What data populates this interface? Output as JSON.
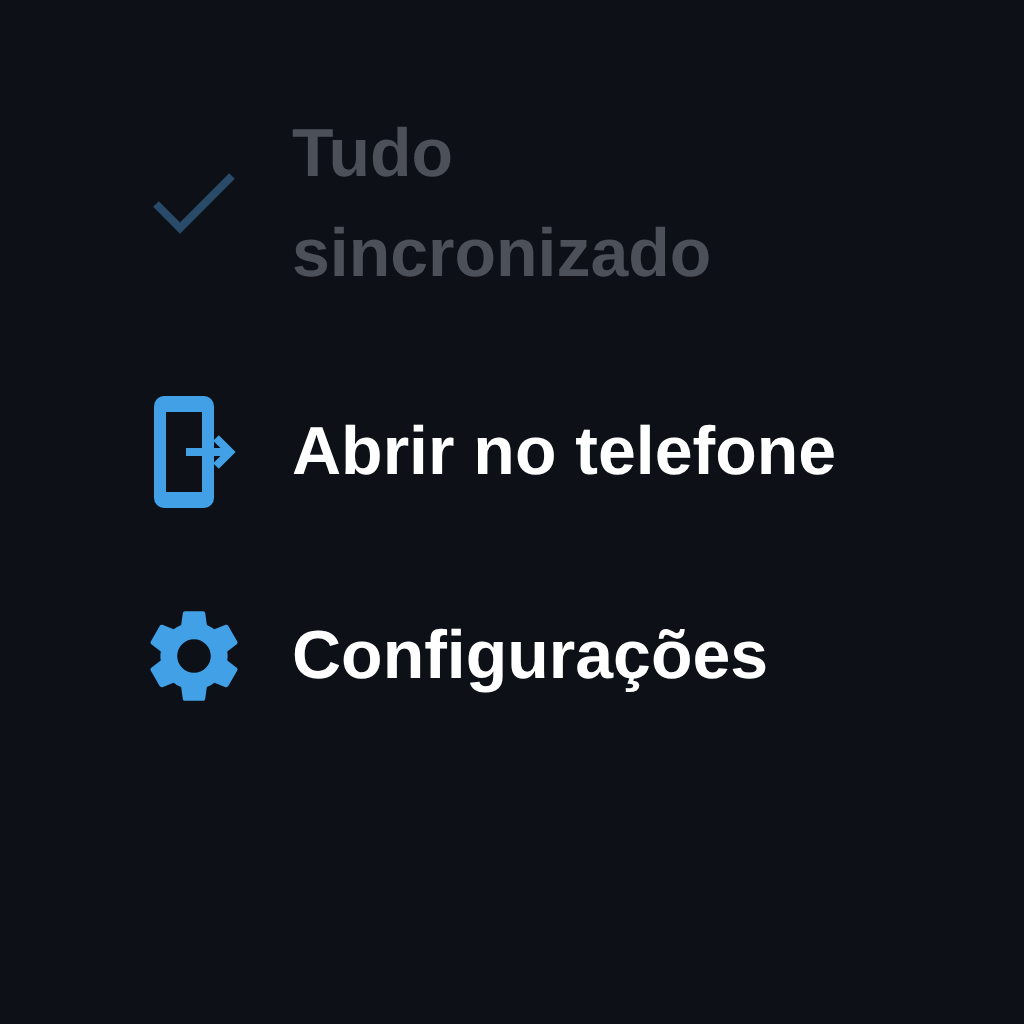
{
  "menu": {
    "items": [
      {
        "kind": "check",
        "label": "Tudo sincronizado",
        "disabled": true
      },
      {
        "kind": "phone",
        "label": "Abrir no telefone",
        "disabled": false
      },
      {
        "kind": "gear",
        "label": "Configurações",
        "disabled": false
      }
    ]
  }
}
